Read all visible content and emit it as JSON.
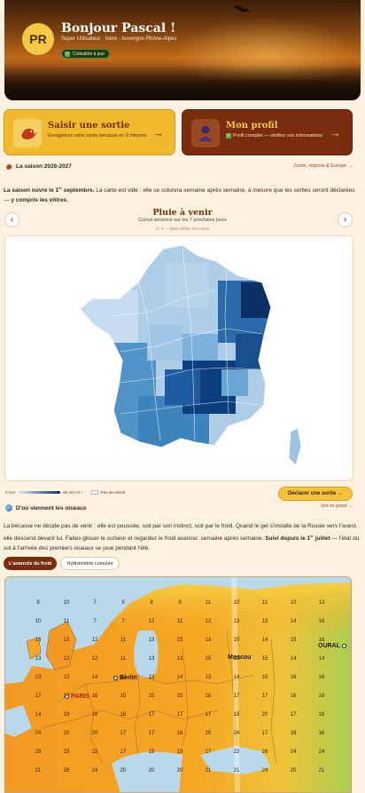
{
  "hero": {
    "avatar_initials": "PR",
    "greeting": "Bonjour Pascal !",
    "subtitle": "Super Utilisateur · Isère · Auvergne-Rhône-Alpes",
    "badge": "Cotisation à jour"
  },
  "cards": {
    "outing": {
      "title": "Saisir une sortie",
      "desc": "Enregistrez votre sortie bécasse en 2 minutes",
      "arrow": "→"
    },
    "profile": {
      "title": "Mon profil",
      "desc": "Profil complet — vérifiez vos informations",
      "arrow": "→",
      "check": "✓"
    }
  },
  "season": {
    "label": "La saison 2026-2027",
    "zoom_link": "Zoom, régions & Europe →"
  },
  "intro": {
    "part1": "La saison ouvre le 1",
    "sup": "er",
    "part2": " septembre.",
    "part3": " La carte est vide : elle se colorera semaine après semaine, à mesure que les sorties seront déclarées — ",
    "part4": "y compris les vôtres."
  },
  "map": {
    "title": "Pluie à venir",
    "subtitle": "Cumul annoncé sur les 7 prochains jours",
    "counter": "3 / 4 — faites défiler les cartes",
    "prev": "‹",
    "next": "›",
    "legend_min": "0 mm",
    "legend_max": "60 mm et +",
    "legend_none": "Pas de relevé"
  },
  "actions": {
    "declare": "Déclarer une sortie →",
    "see_big": "Voir en grand →"
  },
  "birds": {
    "heading": "D'où viennent les oiseaux",
    "p1": "La bécasse ne décide pas de venir : elle est poussée, soit par son instinct, soit par le froid. Quand le gel s'installe de la Russie vers l'ouest, elle descend devant lui. Faites glisser le curseur et regardez le froid avancer, semaine après semaine.",
    "p2": " Suivi depuis le 1",
    "sup": "er",
    "p3": " juillet",
    "p4": " — l'état du sol à l'arrivée des premiers oiseaux se joue pendant l'été.",
    "tab_active": "L'avancée du froid",
    "tab_idle": "Hydrométrie cumulée"
  },
  "europe": {
    "cities": [
      "PARIS",
      "Berlin",
      "Moscou",
      "OURAL"
    ],
    "numbers": [
      [
        "9",
        "10",
        "7",
        "9",
        "8",
        "9",
        "11",
        "10",
        "11",
        "10",
        "13"
      ],
      [
        "10",
        "11",
        "7",
        "7",
        "12",
        "11",
        "12",
        "13",
        "13",
        "14",
        "16"
      ],
      [
        "13",
        "13",
        "12",
        "11",
        "13",
        "15",
        "13",
        "15",
        "14",
        "15",
        "16"
      ],
      [
        "13",
        "13",
        "12",
        "11",
        "13",
        "13",
        "15",
        "13",
        "15",
        "14",
        "14"
      ],
      [
        "13",
        "13",
        "14",
        "13",
        "13",
        "14",
        "13",
        "14",
        "15",
        "16",
        "16"
      ],
      [
        "17",
        "17",
        "16",
        "15",
        "15",
        "15",
        "16",
        "17",
        "17",
        "16",
        "16"
      ],
      [
        "14",
        "19",
        "18",
        "16",
        "17",
        "17",
        "17",
        "18",
        "20",
        "17",
        "18"
      ],
      [
        "24",
        "20",
        "20",
        "17",
        "17",
        "18",
        "20",
        "24",
        "17",
        "18",
        "16"
      ],
      [
        "28",
        "23",
        "22",
        "17",
        "19",
        "19",
        "17",
        "22",
        "26",
        "24",
        "24"
      ],
      [
        "21",
        "26",
        "24",
        "20",
        "20",
        "20",
        "21",
        "21",
        "24",
        "20",
        "21"
      ]
    ]
  },
  "colors": {
    "accent": "#7a2c0e",
    "gold": "#f0b92e",
    "cream": "#fdf1e0"
  }
}
